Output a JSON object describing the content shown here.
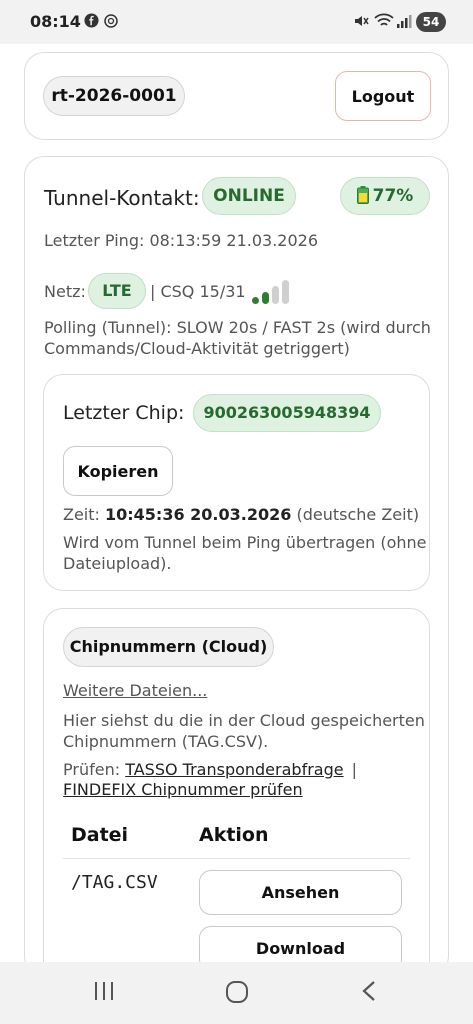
{
  "status": {
    "time": "08:14",
    "battery": "54"
  },
  "header": {
    "device_id": "rt-2026-0001",
    "logout_label": "Logout"
  },
  "tunnel": {
    "title": "Tunnel-Kontakt:",
    "state": "ONLINE",
    "battery_icon": "battery-icon",
    "battery_pct": "77%",
    "last_ping": "Letzter Ping: 08:13:59 21.03.2026",
    "net_label": "Netz:",
    "net_type": "LTE",
    "csq": "| CSQ 15/31",
    "signal_bars_filled": 2,
    "signal_bars_total": 4,
    "polling_line1": "Polling (Tunnel): SLOW 20s / FAST 2s (wird durch",
    "polling_line2": "Commands/Cloud-Aktivität getriggert)",
    "colors": {
      "online_bg": "#dff2e1",
      "online_text": "#27692f",
      "signal_on": "#2e7d32",
      "signal_off": "#cfcfcf"
    }
  },
  "chip": {
    "label": "Letzter Chip:",
    "number": "900263005948394",
    "copy_label": "Kopieren",
    "time_prefix": "Zeit: ",
    "time_value": "10:45:36 20.03.2026",
    "time_suffix": " (deutsche Zeit)",
    "note_line1": "Wird vom Tunnel beim Ping übertragen (ohne",
    "note_line2": "Dateiupload)."
  },
  "cloud": {
    "title": "Chipnummern (Cloud)",
    "more_link": "Weitere Dateien...",
    "desc_line1": "Hier siehst du die in der Cloud gespeicherten",
    "desc_line2": "Chipnummern (TAG.CSV).",
    "check_prefix": "Prüfen: ",
    "link_tasso": "TASSO Transponderabfrage",
    "separator": "|",
    "link_findefix": "FINDEFIX Chipnummer prüfen",
    "col_file": "Datei",
    "col_action": "Aktion",
    "rows": [
      {
        "file": "/TAG.CSV",
        "view_label": "Ansehen",
        "download_label": "Download"
      }
    ]
  }
}
